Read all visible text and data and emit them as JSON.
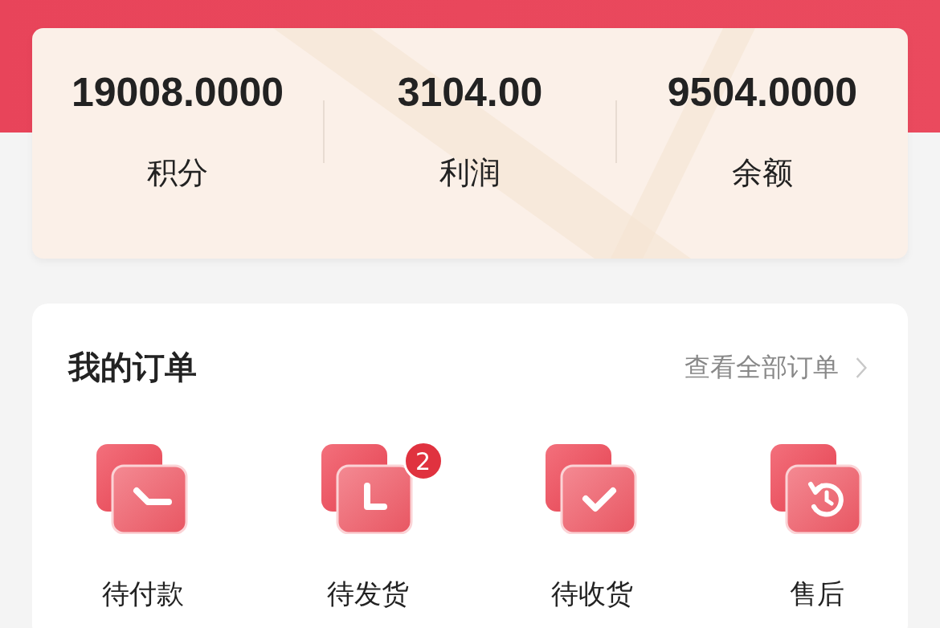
{
  "stats": [
    {
      "value": "19008.0000",
      "label": "积分"
    },
    {
      "value": "3104.00",
      "label": "利润"
    },
    {
      "value": "9504.0000",
      "label": "余额"
    }
  ],
  "orders": {
    "title": "我的订单",
    "view_all": "查看全部订单",
    "items": [
      {
        "label": "待付款",
        "kind": "pay"
      },
      {
        "label": "待发货",
        "kind": "ship",
        "badge": "2"
      },
      {
        "label": "待收货",
        "kind": "receive"
      },
      {
        "label": "售后",
        "kind": "aftersale"
      }
    ]
  }
}
